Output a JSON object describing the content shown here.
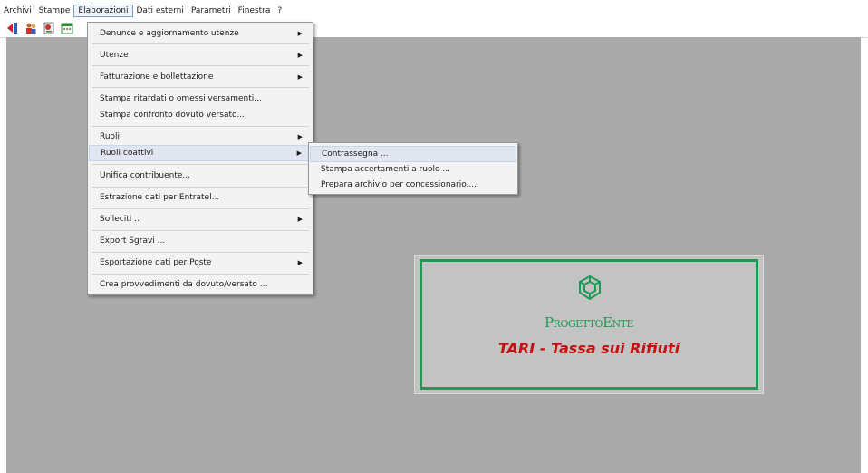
{
  "menubar": {
    "items": [
      "Archivi",
      "Stampe",
      "Elaborazioni",
      "Dati esterni",
      "Parametri",
      "Finestra",
      "?"
    ],
    "open_index": 2
  },
  "toolbar": {
    "icons": [
      "back-arrow-icon",
      "people-icon",
      "report-icon",
      "calendar-icon"
    ]
  },
  "elaborazioni_menu": {
    "items": [
      {
        "label": "Denunce e aggiornamento utenze",
        "submenu": true
      },
      {
        "label": "Utenze",
        "submenu": true
      },
      {
        "label": "Fatturazione e bollettazione",
        "submenu": true
      },
      {
        "label": "Stampa ritardati o omessi versamenti...",
        "submenu": false
      },
      {
        "label": "Stampa confronto dovuto versato...",
        "submenu": false
      },
      {
        "label": "Ruoli",
        "submenu": true
      },
      {
        "label": "Ruoli coattivi",
        "submenu": true,
        "highlighted": true
      },
      {
        "label": "Unifica contribuente...",
        "submenu": false
      },
      {
        "label": "Estrazione dati per Entratel...",
        "submenu": false
      },
      {
        "label": "Solleciti ..",
        "submenu": true
      },
      {
        "label": "Export Sgravi ...",
        "submenu": false
      },
      {
        "label": "Esportazione dati per Poste",
        "submenu": true
      },
      {
        "label": "Crea provvedimenti da dovuto/versato ...",
        "submenu": false
      }
    ]
  },
  "ruoli_coattivi_submenu": {
    "items": [
      {
        "label": "Contrassegna ...",
        "highlighted": true
      },
      {
        "label": "Stampa accertamenti a ruolo ..."
      },
      {
        "label": "Prepara archivio per concessionario...."
      }
    ]
  },
  "splash": {
    "brand": "ProgettoEnte",
    "app_name": "TARI - Tassa sui Rifiuti",
    "brand_color": "#1f9a55",
    "title_color": "#c41010"
  }
}
